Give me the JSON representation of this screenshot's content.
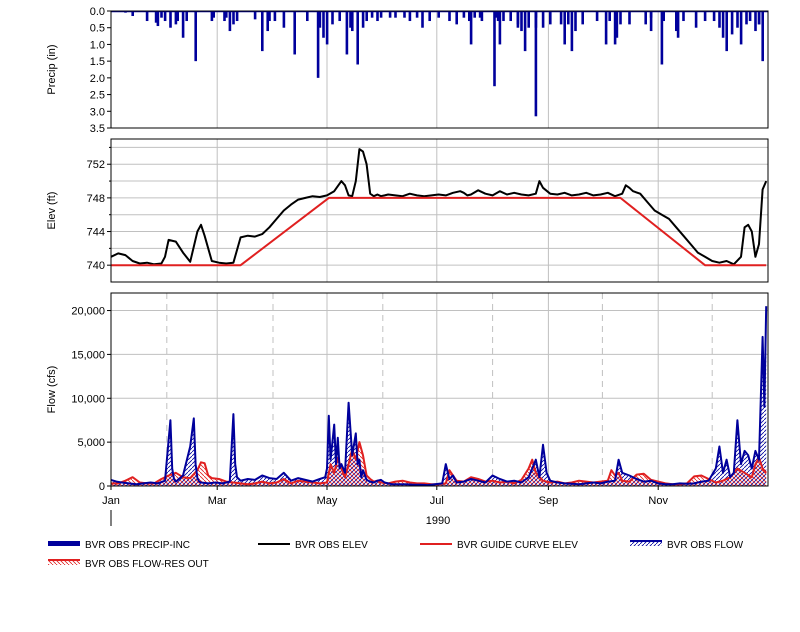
{
  "colors": {
    "precip": "#00009c",
    "obs_elev": "#000000",
    "guide_curve": "#e02020",
    "obs_flow": "#00009c",
    "res_out": "#e02020",
    "grid": "#c0c0c0",
    "grid_dashed": "#c0c0c0",
    "frame": "#000000"
  },
  "chart_data": [
    {
      "type": "bar",
      "ylabel": "Precip (in)",
      "ylim": [
        0,
        3.5
      ],
      "inverted": true,
      "yticks": [
        "0.0",
        "0.5",
        "1.0",
        "1.5",
        "2.0",
        "2.5",
        "3.0",
        "3.5"
      ],
      "series": [
        {
          "name": "BVR OBS PRECIP-INC",
          "days": [
            8,
            12,
            25,
            26,
            28,
            30,
            33,
            36,
            37,
            40,
            42,
            47,
            56,
            57,
            63,
            64,
            66,
            68,
            70,
            80,
            84,
            87,
            91,
            96,
            102,
            109,
            115,
            116,
            118,
            120,
            123,
            127,
            131,
            134,
            137,
            140,
            142,
            145,
            148,
            150,
            155,
            163,
            166,
            170,
            173,
            177,
            182,
            188,
            192,
            196,
            199,
            202,
            206,
            214,
            215,
            218,
            222,
            226,
            230,
            232,
            236,
            240,
            250,
            254,
            256,
            258,
            262,
            270,
            275,
            277,
            281,
            283,
            288,
            297,
            300,
            307,
            314,
            318,
            325,
            335,
            338,
            340,
            342,
            345,
            348,
            350,
            353,
            355,
            358,
            360,
            362
          ],
          "values": [
            0.05,
            0.15,
            0.35,
            0.45,
            0.2,
            0.3,
            0.5,
            0.4,
            0.3,
            0.8,
            0.3,
            1.5,
            0.3,
            0.2,
            0.3,
            0.2,
            0.6,
            0.4,
            0.3,
            0.25,
            1.2,
            0.6,
            0.3,
            0.5,
            1.3,
            0.3,
            2.0,
            0.5,
            0.8,
            1.0,
            0.4,
            0.3,
            1.3,
            0.6,
            1.6,
            0.5,
            0.3,
            0.2,
            0.3,
            0.2,
            0.2,
            0.2,
            0.3,
            0.2,
            0.5,
            0.3,
            0.2,
            0.3,
            0.4,
            0.2,
            0.3,
            0.2,
            0.3,
            0.2,
            0.3,
            0.3,
            0.3,
            0.4,
            1.2,
            0.5,
            0.2,
            0.5,
            0.4,
            0.4,
            1.2,
            0.6,
            0.4,
            0.3,
            1.0,
            0.3,
            0.8,
            0.4,
            0.4,
            0.4,
            0.2,
            0.3,
            0.6,
            0.3,
            0.5,
            0.3,
            0.5,
            0.8,
            1.2,
            0.7,
            0.5,
            1.0,
            0.4,
            0.3,
            0.6,
            0.4,
            1.5
          ]
        }
      ],
      "extra_bars": [
        [
          20,
          0.3
        ],
        [
          88,
          0.3
        ],
        [
          133,
          0.5
        ],
        [
          158,
          0.2
        ],
        [
          200,
          1.0
        ],
        [
          205,
          0.2
        ],
        [
          213,
          2.25
        ],
        [
          216,
          1.0
        ],
        [
          228,
          0.6
        ],
        [
          236,
          0.5
        ],
        [
          244,
          0.4
        ],
        [
          300,
          0.6
        ],
        [
          315,
          0.8
        ],
        [
          330,
          0.3
        ],
        [
          226,
          0.5
        ],
        [
          236,
          3.15
        ],
        [
          252,
          1.0
        ],
        [
          280,
          1.0
        ],
        [
          306,
          1.6
        ],
        [
          360,
          0.4
        ]
      ]
    },
    {
      "type": "line",
      "ylabel": "Elev (ft)",
      "ylim": [
        738,
        755
      ],
      "yticks": [
        "740",
        "744",
        "748",
        "752"
      ],
      "series": [
        {
          "name": "BVR OBS ELEV",
          "x": [
            0,
            4,
            8,
            12,
            16,
            20,
            24,
            28,
            30,
            32,
            36,
            40,
            44,
            48,
            50,
            52,
            56,
            60,
            64,
            68,
            72,
            76,
            80,
            84,
            88,
            92,
            96,
            100,
            104,
            108,
            112,
            116,
            120,
            124,
            128,
            130,
            132,
            134,
            136,
            138,
            140,
            142,
            144,
            146,
            148,
            150,
            152,
            154,
            158,
            162,
            166,
            170,
            174,
            178,
            182,
            186,
            190,
            194,
            196,
            198,
            200,
            204,
            208,
            212,
            216,
            220,
            224,
            228,
            232,
            236,
            238,
            240,
            244,
            248,
            252,
            256,
            260,
            264,
            268,
            272,
            276,
            280,
            284,
            286,
            288,
            290,
            294,
            298,
            302,
            306,
            310,
            314,
            318,
            322,
            326,
            330,
            334,
            338,
            342,
            346,
            350,
            352,
            354,
            356,
            358,
            360,
            362,
            364
          ],
          "values": [
            741,
            741.4,
            741.2,
            740.5,
            740.2,
            740.3,
            740.1,
            740.2,
            741,
            743,
            742.8,
            741.5,
            740.4,
            744,
            744.8,
            743.5,
            740.5,
            740.3,
            740.2,
            740.3,
            743.3,
            743.5,
            743.4,
            743.7,
            744.5,
            745.5,
            746.5,
            747.2,
            747.8,
            748.0,
            748.2,
            748.1,
            748.3,
            748.8,
            750.0,
            749.5,
            748.3,
            748.2,
            750.0,
            753.8,
            753.5,
            752.0,
            748.5,
            748.2,
            748.4,
            748.2,
            748.3,
            748.4,
            748.3,
            748.2,
            748.5,
            748.3,
            748.2,
            748.3,
            748.4,
            748.3,
            748.6,
            748.8,
            748.6,
            748.3,
            748.4,
            748.9,
            748.5,
            748.3,
            748.8,
            748.4,
            748.6,
            748.4,
            748.3,
            748.5,
            750.0,
            749.2,
            748.5,
            748.4,
            748.6,
            748.3,
            748.4,
            748.6,
            748.3,
            748.4,
            748.6,
            748.2,
            748.5,
            749.5,
            749.2,
            748.8,
            748.5,
            747.5,
            746.5,
            746.0,
            745.5,
            744.5,
            743.5,
            742.5,
            741.5,
            741.0,
            740.5,
            740.3,
            740.5,
            740.1,
            741.0,
            744.5,
            744.8,
            744.0,
            741.0,
            742.5,
            749.0,
            750.0
          ]
        },
        {
          "name": "BVR GUIDE CURVE ELEV",
          "x": [
            0,
            72,
            121,
            283,
            330,
            364
          ],
          "values": [
            740,
            740,
            748,
            748,
            740,
            740
          ]
        }
      ]
    },
    {
      "type": "line",
      "ylabel": "Flow (cfs)",
      "xlabel": "1990",
      "ylim": [
        0,
        22000
      ],
      "yticks": [
        "0",
        "5,000",
        "10,000",
        "15,000",
        "20,000"
      ],
      "xticks": [
        "Jan",
        "Mar",
        "May",
        "Jul",
        "Sep",
        "Nov"
      ],
      "xtick_days": [
        0,
        59,
        120,
        181,
        243,
        304
      ],
      "dashed_days": [
        31,
        90,
        151,
        212,
        273,
        334
      ],
      "xlim": [
        0,
        365
      ],
      "series": [
        {
          "name": "BVR OBS FLOW",
          "x": [
            0,
            3,
            6,
            10,
            14,
            18,
            22,
            26,
            30,
            33,
            34,
            35,
            36,
            40,
            44,
            46,
            47,
            48,
            49,
            50,
            54,
            58,
            62,
            66,
            68,
            69,
            70,
            72,
            76,
            80,
            84,
            88,
            92,
            96,
            100,
            104,
            108,
            112,
            116,
            119,
            120,
            121,
            122,
            124,
            125,
            126,
            127,
            128,
            130,
            132,
            134,
            136,
            137,
            138,
            139,
            140,
            142,
            144,
            146,
            148,
            150,
            152,
            154,
            156,
            160,
            164,
            168,
            172,
            176,
            180,
            184,
            186,
            188,
            190,
            192,
            196,
            200,
            204,
            208,
            212,
            216,
            220,
            224,
            228,
            232,
            236,
            238,
            240,
            242,
            244,
            248,
            252,
            256,
            260,
            264,
            268,
            272,
            276,
            280,
            282,
            284,
            288,
            292,
            296,
            300,
            304,
            308,
            312,
            316,
            320,
            324,
            328,
            332,
            336,
            338,
            340,
            342,
            344,
            346,
            348,
            350,
            352,
            354,
            356,
            358,
            360,
            362,
            363,
            364
          ],
          "values": [
            700,
            500,
            400,
            300,
            200,
            300,
            400,
            300,
            600,
            7500,
            2000,
            800,
            500,
            1200,
            4500,
            7700,
            2500,
            900,
            500,
            400,
            300,
            400,
            300,
            500,
            8200,
            2500,
            1000,
            600,
            800,
            700,
            1200,
            900,
            800,
            1500,
            600,
            900,
            700,
            500,
            800,
            1000,
            2000,
            8000,
            3000,
            7000,
            2500,
            5500,
            2000,
            2500,
            1500,
            9500,
            3500,
            6000,
            2500,
            3000,
            1000,
            1800,
            700,
            500,
            400,
            600,
            700,
            400,
            300,
            200,
            200,
            200,
            150,
            150,
            100,
            200,
            300,
            2500,
            800,
            1200,
            400,
            500,
            800,
            600,
            400,
            1200,
            800,
            500,
            600,
            400,
            1000,
            3000,
            1000,
            4700,
            1500,
            600,
            400,
            300,
            250,
            200,
            300,
            400,
            300,
            500,
            600,
            3000,
            1500,
            1200,
            800,
            500,
            600,
            300,
            200,
            200,
            300,
            250,
            300,
            500,
            600,
            2000,
            4500,
            1500,
            3000,
            1000,
            1500,
            7500,
            2500,
            4000,
            3500,
            2000,
            4000,
            3000,
            17000,
            9000,
            20500
          ]
        },
        {
          "name": "BVR OBS FLOW-RES OUT",
          "x": [
            0,
            4,
            8,
            12,
            16,
            20,
            24,
            28,
            32,
            36,
            40,
            44,
            48,
            50,
            52,
            54,
            56,
            60,
            64,
            68,
            72,
            76,
            80,
            84,
            88,
            92,
            96,
            100,
            104,
            108,
            112,
            116,
            120,
            122,
            124,
            126,
            128,
            130,
            132,
            134,
            136,
            138,
            140,
            142,
            144,
            146,
            148,
            150,
            154,
            158,
            162,
            166,
            170,
            174,
            178,
            182,
            186,
            188,
            190,
            192,
            196,
            200,
            204,
            208,
            212,
            216,
            220,
            224,
            228,
            232,
            234,
            236,
            240,
            244,
            248,
            252,
            256,
            260,
            264,
            268,
            272,
            276,
            278,
            280,
            282,
            284,
            288,
            292,
            296,
            300,
            304,
            308,
            312,
            316,
            320,
            324,
            328,
            332,
            336,
            340,
            344,
            348,
            352,
            356,
            358,
            360,
            362,
            364
          ],
          "values": [
            300,
            300,
            600,
            1000,
            400,
            300,
            300,
            800,
            1200,
            1500,
            1000,
            900,
            1800,
            2700,
            2600,
            1200,
            900,
            800,
            500,
            400,
            300,
            200,
            300,
            500,
            300,
            400,
            800,
            300,
            600,
            500,
            400,
            300,
            400,
            2500,
            1500,
            3200,
            2000,
            1000,
            2500,
            4200,
            3000,
            5000,
            3500,
            1200,
            800,
            500,
            600,
            400,
            300,
            500,
            600,
            400,
            300,
            300,
            200,
            200,
            300,
            1800,
            1200,
            600,
            500,
            1000,
            800,
            500,
            600,
            400,
            500,
            300,
            700,
            2000,
            3000,
            1500,
            600,
            400,
            500,
            300,
            400,
            600,
            500,
            400,
            500,
            600,
            1800,
            1200,
            1500,
            600,
            500,
            1300,
            1400,
            700,
            500,
            300,
            200,
            200,
            300,
            1100,
            1200,
            800,
            400,
            600,
            1000,
            2000,
            1500,
            1000,
            2500,
            3200,
            2000,
            1500
          ]
        }
      ]
    }
  ],
  "legend": [
    {
      "key": "precip",
      "label": "BVR OBS PRECIP-INC",
      "style": "thick"
    },
    {
      "key": "obs_elev",
      "label": "BVR OBS ELEV",
      "style": "line"
    },
    {
      "key": "guide_curve",
      "label": "BVR GUIDE CURVE ELEV",
      "style": "line"
    },
    {
      "key": "obs_flow",
      "label": "BVR OBS FLOW",
      "style": "hatch"
    },
    {
      "key": "res_out",
      "label": "BVR OBS FLOW-RES OUT",
      "style": "hatch"
    }
  ]
}
